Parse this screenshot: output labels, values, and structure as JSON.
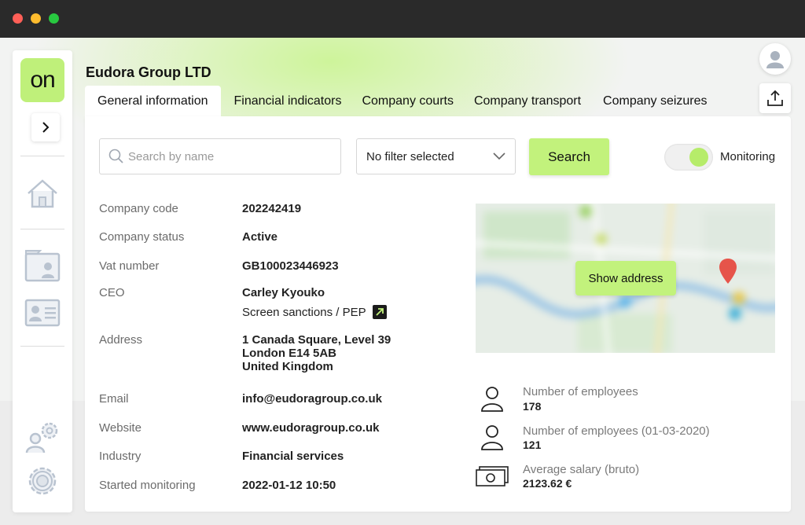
{
  "window": {
    "controls": [
      "close",
      "minimize",
      "maximize"
    ]
  },
  "sidebar": {
    "logo_text": "on",
    "items": [
      {
        "icon": "home-icon"
      },
      {
        "icon": "folder-person-icon"
      },
      {
        "icon": "id-card-icon"
      },
      {
        "icon": "user-settings-icon"
      },
      {
        "icon": "gear-icon"
      }
    ]
  },
  "header": {
    "company_name": "Eudora Group LTD",
    "tabs": [
      {
        "label": "General information",
        "active": true
      },
      {
        "label": "Financial indicators",
        "active": false
      },
      {
        "label": "Company courts",
        "active": false
      },
      {
        "label": "Company transport",
        "active": false
      },
      {
        "label": "Company seizures",
        "active": false
      }
    ]
  },
  "toolbar": {
    "search_placeholder": "Search by name",
    "search_value": "",
    "filter_value": "No filter selected",
    "search_label": "Search",
    "monitoring_label": "Monitoring",
    "monitoring_on": true
  },
  "details": {
    "company_code": {
      "label": "Company code",
      "value": "202242419"
    },
    "company_status": {
      "label": "Company status",
      "value": "Active"
    },
    "vat_number": {
      "label": "Vat number",
      "value": "GB100023446923"
    },
    "ceo": {
      "label": "CEO",
      "value": "Carley Kyouko",
      "sanctions_link": "Screen sanctions / PEP"
    },
    "address": {
      "label": "Address",
      "lines": [
        "1 Canada Square, Level 39",
        "London E14 5AB",
        "United Kingdom"
      ]
    },
    "email": {
      "label": "Email",
      "value": "info@eudoragroup.co.uk"
    },
    "website": {
      "label": "Website",
      "value": "www.eudoragroup.co.uk"
    },
    "industry": {
      "label": "Industry",
      "value": "Financial services"
    },
    "started_monitoring": {
      "label": "Started monitoring",
      "value": "2022-01-12 10:50"
    }
  },
  "map": {
    "button_label": "Show address"
  },
  "stats": [
    {
      "label": "Number of employees",
      "value": "178",
      "icon": "person-icon"
    },
    {
      "label": "Number of employees (01-03-2020)",
      "value": "121",
      "icon": "person-icon"
    },
    {
      "label": "Average salary (bruto)",
      "value": "2123.62 €",
      "icon": "banknotes-icon"
    }
  ],
  "colors": {
    "accent": "#c2f27c",
    "logo_bg": "#bff07a",
    "titlebar": "#2a2a2a",
    "map_pin": "#e63a2f"
  }
}
